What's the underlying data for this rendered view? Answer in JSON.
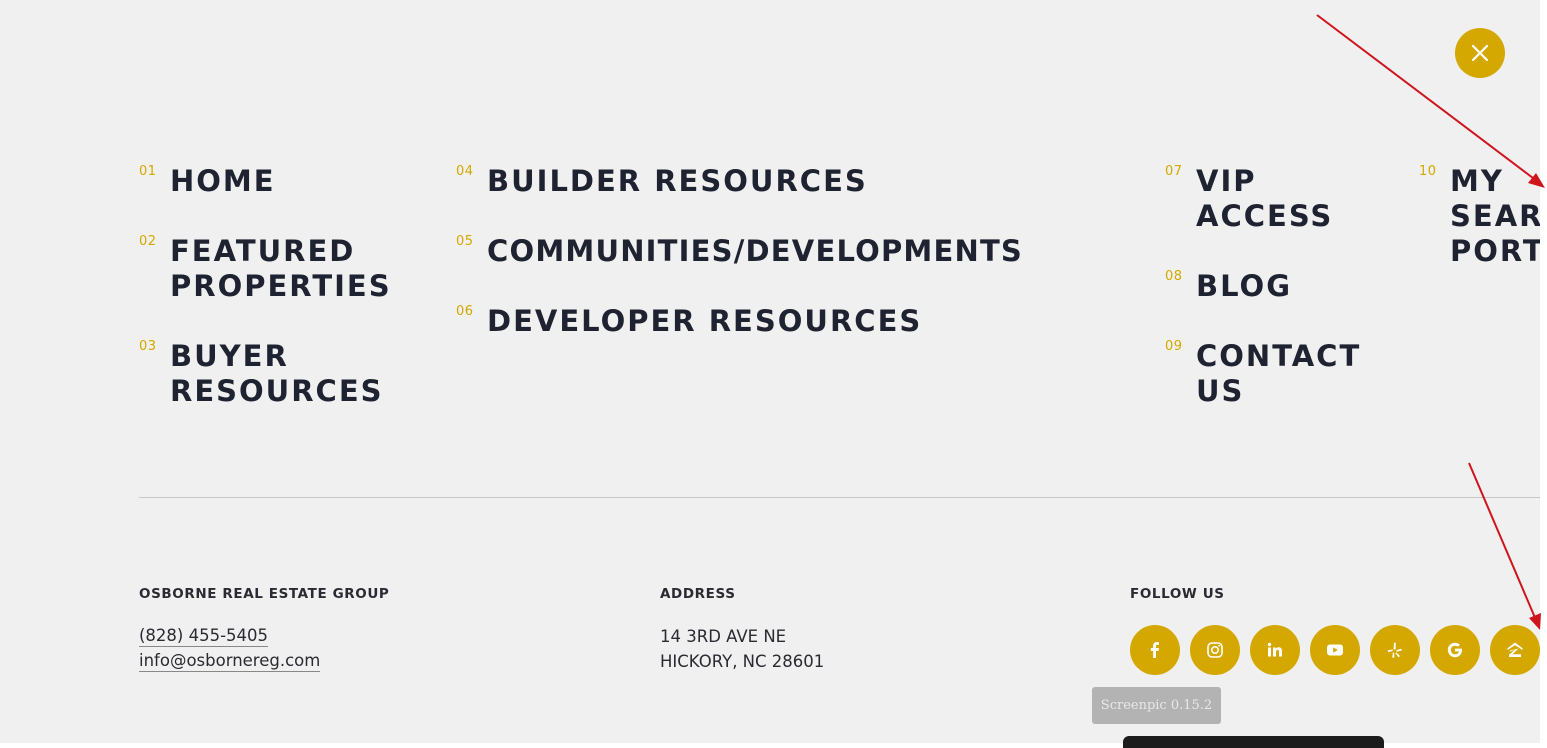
{
  "menu": {
    "items": [
      {
        "num": "01",
        "label": "HOME"
      },
      {
        "num": "02",
        "label": "FEATURED PROPERTIES"
      },
      {
        "num": "03",
        "label": "BUYER RESOURCES"
      },
      {
        "num": "04",
        "label": "BUILDER RESOURCES"
      },
      {
        "num": "05",
        "label": "COMMUNITIES/DEVELOPMENTS"
      },
      {
        "num": "06",
        "label": "DEVELOPER RESOURCES"
      },
      {
        "num": "07",
        "label": "VIP ACCESS"
      },
      {
        "num": "08",
        "label": "BLOG"
      },
      {
        "num": "09",
        "label": "CONTACT US"
      },
      {
        "num": "10",
        "label": "MY SEARCH PORTAL"
      }
    ]
  },
  "footer": {
    "company_heading": "OSBORNE REAL ESTATE GROUP",
    "phone": "(828) 455-5405",
    "email": "info@osbornereg.com",
    "address_heading": "ADDRESS",
    "address_line1": "14 3RD AVE NE",
    "address_line2": "HICKORY, NC 28601",
    "follow_heading": "FOLLOW US",
    "social_icons": [
      "facebook-icon",
      "instagram-icon",
      "linkedin-icon",
      "youtube-icon",
      "yelp-icon",
      "google-icon",
      "zillow-icon"
    ]
  },
  "tooltip": "Screenpic 0.15.2",
  "colors": {
    "accent": "#d4a800",
    "text": "#1f2230",
    "background": "#f0f0f0",
    "annotation": "#d0141c"
  }
}
